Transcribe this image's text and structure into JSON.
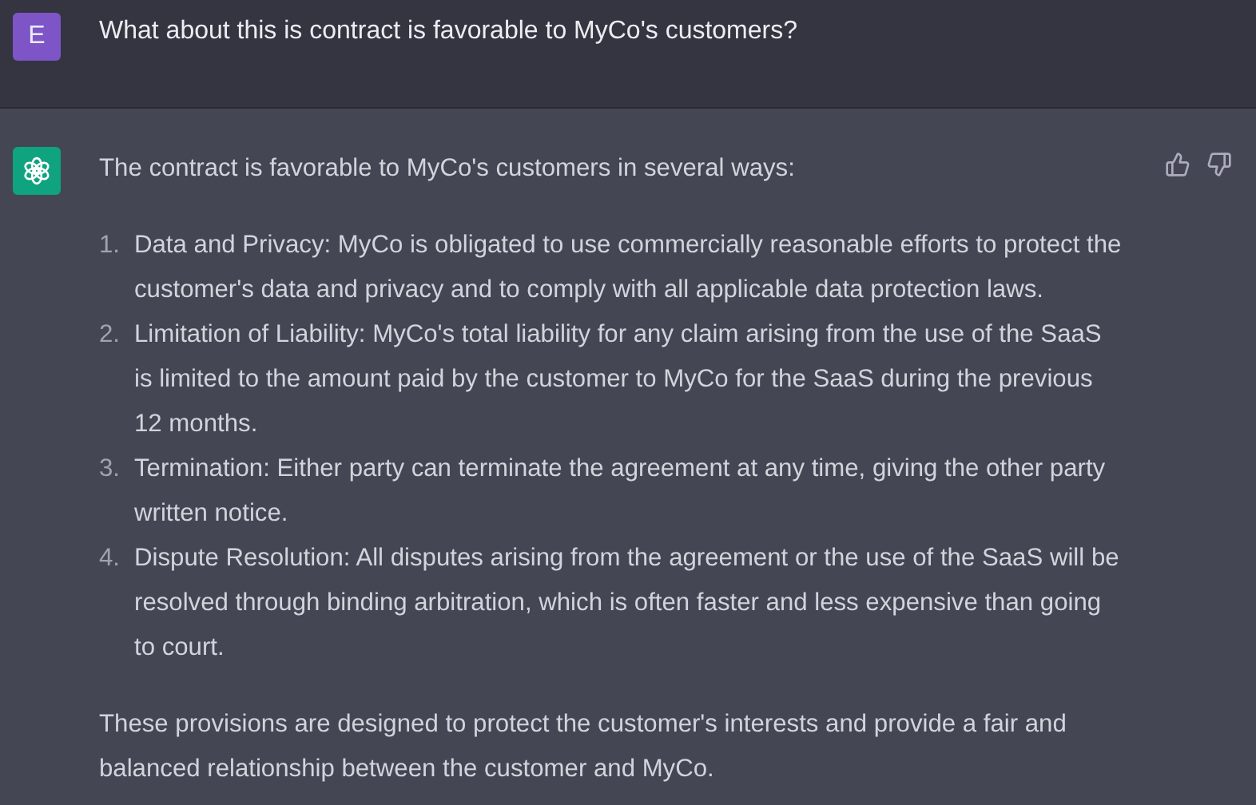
{
  "user_message": {
    "avatar": "E",
    "text": "What about this is contract is favorable to MyCo's customers?"
  },
  "assistant_message": {
    "intro": "The contract is favorable to MyCo's customers in several ways:",
    "items": [
      {
        "number": "1.",
        "text": "Data and Privacy: MyCo is obligated to use commercially reasonable efforts to protect the customer's data and privacy and to comply with all applicable data protection laws."
      },
      {
        "number": "2.",
        "text": "Limitation of Liability: MyCo's total liability for any claim arising from the use of the SaaS is limited to the amount paid by the customer to MyCo for the SaaS during the previous 12 months."
      },
      {
        "number": "3.",
        "text": "Termination: Either party can terminate the agreement at any time, giving the other party written notice."
      },
      {
        "number": "4.",
        "text": "Dispute Resolution: All disputes arising from the agreement or the use of the SaaS will be resolved through binding arbitration, which is often faster and less expensive than going to court."
      }
    ],
    "conclusion": "These provisions are designed to protect the customer's interests and provide a fair and balanced relationship between the customer and MyCo."
  }
}
